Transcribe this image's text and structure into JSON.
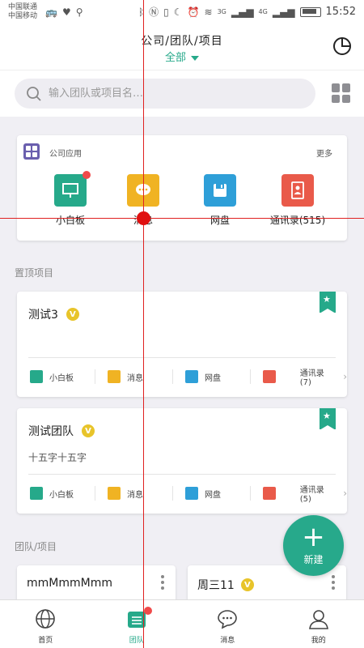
{
  "status_bar": {
    "carrier_1": "中国联通",
    "carrier_2": "中国移动",
    "time": "15:52",
    "signal_1": "3G",
    "signal_2": "4G"
  },
  "header": {
    "title": "公司/团队/项目",
    "filter": "全部"
  },
  "search": {
    "placeholder": "输入团队或项目名…"
  },
  "company_apps": {
    "title": "公司应用",
    "more": "更多",
    "items": [
      {
        "label": "小白板",
        "color": "#26a98a",
        "icon": "whiteboard-icon",
        "has_badge": true
      },
      {
        "label": "消息",
        "color": "#f0b323",
        "icon": "chat-icon",
        "has_badge": false
      },
      {
        "label": "网盘",
        "color": "#2e9fd8",
        "icon": "disk-icon",
        "has_badge": false
      },
      {
        "label": "通讯录(515)",
        "color": "#e95a4a",
        "icon": "contacts-icon",
        "has_badge": false
      }
    ]
  },
  "pinned": {
    "section_title": "置顶项目",
    "projects": [
      {
        "name": "测试3",
        "desc": "",
        "actions": [
          "小白板",
          "消息",
          "网盘",
          "通讯录(7)"
        ]
      },
      {
        "name": "测试团队",
        "desc": "十五字十五字",
        "actions": [
          "小白板",
          "消息",
          "网盘",
          "通讯录(5)"
        ]
      }
    ]
  },
  "teams": {
    "section_title": "团队/项目",
    "items": [
      {
        "name": "mmMmmMmm",
        "verified": false
      },
      {
        "name": "周三11",
        "verified": true
      }
    ]
  },
  "fab": {
    "label": "新建"
  },
  "tabbar": {
    "tabs": [
      {
        "label": "首页",
        "icon": "globe-icon",
        "active": false
      },
      {
        "label": "团队",
        "icon": "team-icon",
        "active": true
      },
      {
        "label": "消息",
        "icon": "message-icon",
        "active": false
      },
      {
        "label": "我的",
        "icon": "person-icon",
        "active": false
      }
    ]
  },
  "colors": {
    "accent": "#26a98a",
    "badge_red": "#f04a4a",
    "verified_yellow": "#e8c42a"
  }
}
